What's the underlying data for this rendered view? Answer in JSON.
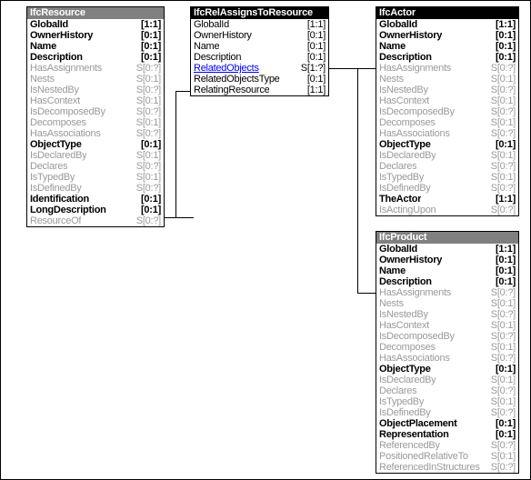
{
  "diagram": {
    "title": "IfcRelAssignsToResource relationship diagram",
    "colors": {
      "header_gray": "#808080",
      "header_black": "#000000",
      "direct_attribute": "#000000",
      "inherited_attribute": "#9a9a9a",
      "link_attribute": "#0000ee",
      "border": "#000000",
      "background": "#ffffff"
    }
  },
  "entities": [
    {
      "name": "IfcResource",
      "header_style": "gray",
      "attributes": [
        {
          "name": "GlobalId",
          "cardinality": "[1:1]",
          "kind": "direct"
        },
        {
          "name": "OwnerHistory",
          "cardinality": "[0:1]",
          "kind": "direct"
        },
        {
          "name": "Name",
          "cardinality": "[0:1]",
          "kind": "direct"
        },
        {
          "name": "Description",
          "cardinality": "[0:1]",
          "kind": "direct"
        },
        {
          "name": "HasAssignments",
          "cardinality": "S[0:?]",
          "kind": "inherited"
        },
        {
          "name": "Nests",
          "cardinality": "S[0:1]",
          "kind": "inherited"
        },
        {
          "name": "IsNestedBy",
          "cardinality": "S[0:?]",
          "kind": "inherited"
        },
        {
          "name": "HasContext",
          "cardinality": "S[0:1]",
          "kind": "inherited"
        },
        {
          "name": "IsDecomposedBy",
          "cardinality": "S[0:?]",
          "kind": "inherited"
        },
        {
          "name": "Decomposes",
          "cardinality": "S[0:1]",
          "kind": "inherited"
        },
        {
          "name": "HasAssociations",
          "cardinality": "S[0:?]",
          "kind": "inherited"
        },
        {
          "name": "ObjectType",
          "cardinality": "[0:1]",
          "kind": "direct"
        },
        {
          "name": "IsDeclaredBy",
          "cardinality": "S[0:1]",
          "kind": "inherited"
        },
        {
          "name": "Declares",
          "cardinality": "S[0:?]",
          "kind": "inherited"
        },
        {
          "name": "IsTypedBy",
          "cardinality": "S[0:1]",
          "kind": "inherited"
        },
        {
          "name": "IsDefinedBy",
          "cardinality": "S[0:?]",
          "kind": "inherited"
        },
        {
          "name": "Identification",
          "cardinality": "[0:1]",
          "kind": "direct"
        },
        {
          "name": "LongDescription",
          "cardinality": "[0:1]",
          "kind": "direct"
        },
        {
          "name": "ResourceOf",
          "cardinality": "S[0:?]",
          "kind": "inherited"
        }
      ]
    },
    {
      "name": "IfcRelAssignsToResource",
      "header_style": "black",
      "attributes": [
        {
          "name": "GlobalId",
          "cardinality": "[1:1]",
          "kind": "plain"
        },
        {
          "name": "OwnerHistory",
          "cardinality": "[0:1]",
          "kind": "plain"
        },
        {
          "name": "Name",
          "cardinality": "[0:1]",
          "kind": "plain"
        },
        {
          "name": "Description",
          "cardinality": "[0:1]",
          "kind": "plain"
        },
        {
          "name": "RelatedObjects",
          "cardinality": "S[1:?]",
          "kind": "link"
        },
        {
          "name": "RelatedObjectsType",
          "cardinality": "[0:1]",
          "kind": "plain"
        },
        {
          "name": "RelatingResource",
          "cardinality": "[1:1]",
          "kind": "plain"
        }
      ]
    },
    {
      "name": "IfcActor",
      "header_style": "black",
      "attributes": [
        {
          "name": "GlobalId",
          "cardinality": "[1:1]",
          "kind": "direct"
        },
        {
          "name": "OwnerHistory",
          "cardinality": "[0:1]",
          "kind": "direct"
        },
        {
          "name": "Name",
          "cardinality": "[0:1]",
          "kind": "direct"
        },
        {
          "name": "Description",
          "cardinality": "[0:1]",
          "kind": "direct"
        },
        {
          "name": "HasAssignments",
          "cardinality": "S[0:?]",
          "kind": "inherited"
        },
        {
          "name": "Nests",
          "cardinality": "S[0:1]",
          "kind": "inherited"
        },
        {
          "name": "IsNestedBy",
          "cardinality": "S[0:?]",
          "kind": "inherited"
        },
        {
          "name": "HasContext",
          "cardinality": "S[0:1]",
          "kind": "inherited"
        },
        {
          "name": "IsDecomposedBy",
          "cardinality": "S[0:?]",
          "kind": "inherited"
        },
        {
          "name": "Decomposes",
          "cardinality": "S[0:1]",
          "kind": "inherited"
        },
        {
          "name": "HasAssociations",
          "cardinality": "S[0:?]",
          "kind": "inherited"
        },
        {
          "name": "ObjectType",
          "cardinality": "[0:1]",
          "kind": "direct"
        },
        {
          "name": "IsDeclaredBy",
          "cardinality": "S[0:1]",
          "kind": "inherited"
        },
        {
          "name": "Declares",
          "cardinality": "S[0:?]",
          "kind": "inherited"
        },
        {
          "name": "IsTypedBy",
          "cardinality": "S[0:1]",
          "kind": "inherited"
        },
        {
          "name": "IsDefinedBy",
          "cardinality": "S[0:?]",
          "kind": "inherited"
        },
        {
          "name": "TheActor",
          "cardinality": "[1:1]",
          "kind": "direct"
        },
        {
          "name": "IsActingUpon",
          "cardinality": "S[0:?]",
          "kind": "inherited"
        }
      ]
    },
    {
      "name": "IfcProduct",
      "header_style": "gray",
      "attributes": [
        {
          "name": "GlobalId",
          "cardinality": "[1:1]",
          "kind": "direct"
        },
        {
          "name": "OwnerHistory",
          "cardinality": "[0:1]",
          "kind": "direct"
        },
        {
          "name": "Name",
          "cardinality": "[0:1]",
          "kind": "direct"
        },
        {
          "name": "Description",
          "cardinality": "[0:1]",
          "kind": "direct"
        },
        {
          "name": "HasAssignments",
          "cardinality": "S[0:?]",
          "kind": "inherited"
        },
        {
          "name": "Nests",
          "cardinality": "S[0:1]",
          "kind": "inherited"
        },
        {
          "name": "IsNestedBy",
          "cardinality": "S[0:?]",
          "kind": "inherited"
        },
        {
          "name": "HasContext",
          "cardinality": "S[0:1]",
          "kind": "inherited"
        },
        {
          "name": "IsDecomposedBy",
          "cardinality": "S[0:?]",
          "kind": "inherited"
        },
        {
          "name": "Decomposes",
          "cardinality": "S[0:1]",
          "kind": "inherited"
        },
        {
          "name": "HasAssociations",
          "cardinality": "S[0:?]",
          "kind": "inherited"
        },
        {
          "name": "ObjectType",
          "cardinality": "[0:1]",
          "kind": "direct"
        },
        {
          "name": "IsDeclaredBy",
          "cardinality": "S[0:1]",
          "kind": "inherited"
        },
        {
          "name": "Declares",
          "cardinality": "S[0:?]",
          "kind": "inherited"
        },
        {
          "name": "IsTypedBy",
          "cardinality": "S[0:1]",
          "kind": "inherited"
        },
        {
          "name": "IsDefinedBy",
          "cardinality": "S[0:?]",
          "kind": "inherited"
        },
        {
          "name": "ObjectPlacement",
          "cardinality": "[0:1]",
          "kind": "direct"
        },
        {
          "name": "Representation",
          "cardinality": "[0:1]",
          "kind": "direct"
        },
        {
          "name": "ReferencedBy",
          "cardinality": "S[0:?]",
          "kind": "inherited"
        },
        {
          "name": "PositionedRelativeTo",
          "cardinality": "S[0:1]",
          "kind": "inherited"
        },
        {
          "name": "ReferencedInStructures",
          "cardinality": "S[0:?]",
          "kind": "inherited"
        }
      ]
    }
  ],
  "connections": [
    {
      "from": "IfcResource.ResourceOf",
      "to": "IfcRelAssignsToResource.RelatingResource"
    },
    {
      "from": "IfcRelAssignsToResource.RelatedObjects",
      "to": "IfcActor.HasAssignments"
    },
    {
      "from": "IfcRelAssignsToResource.RelatedObjects",
      "to": "IfcProduct.HasAssignments"
    }
  ]
}
